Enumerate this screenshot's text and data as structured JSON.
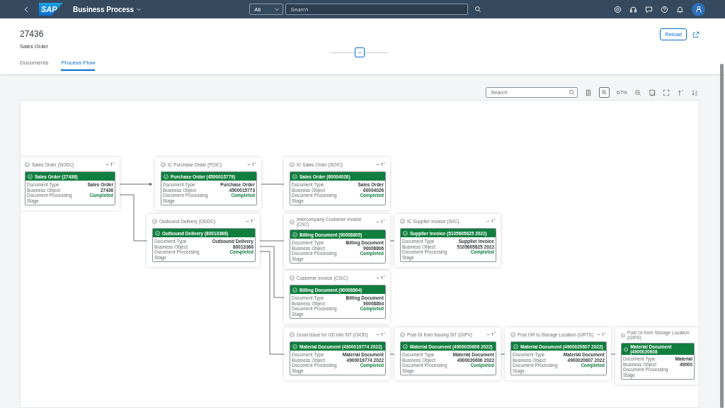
{
  "shell": {
    "logo": "SAP",
    "title": "Business Process",
    "scope": "All",
    "search_placeholder": "Search"
  },
  "object": {
    "title": "27436",
    "subtitle": "Sales Order",
    "reload": "Reload"
  },
  "tabs": [
    {
      "label": "Documents",
      "selected": false
    },
    {
      "label": "Process Flow",
      "selected": true
    }
  ],
  "toolbar": {
    "search_placeholder": "Search",
    "zoom": "67%"
  },
  "lanes": [
    {
      "title": "Sales Order (SOSC)",
      "color": "#107e3e",
      "header": "Sales Order (27436)",
      "rows": [
        {
          "label": "Document Type",
          "value": "Sales Order",
          "kind": "text"
        },
        {
          "label": "Business Object",
          "value": "27436",
          "kind": "text"
        },
        {
          "label": "Document Processing Stage",
          "value": "Completed",
          "kind": "status"
        }
      ]
    },
    {
      "title": "IC Purchase Order (POIC)",
      "color": "#107e3e",
      "header": "Purchase Order (4500015779)",
      "rows": [
        {
          "label": "Document Type",
          "value": "Purchase Order",
          "kind": "text"
        },
        {
          "label": "Business Object",
          "value": "4500015773",
          "kind": "text"
        },
        {
          "label": "Document Processing Stage",
          "value": "Completed",
          "kind": "status"
        }
      ]
    },
    {
      "title": "Outbound Delivery (ODDC)",
      "color": "#107e3e",
      "header": "Outbound Delivery (80013366)",
      "rows": [
        {
          "label": "Document Type",
          "value": "Outbound Delivery",
          "kind": "text"
        },
        {
          "label": "Business Object",
          "value": "80013366",
          "kind": "text"
        },
        {
          "label": "Document Processing Stage",
          "value": "Completed",
          "kind": "status"
        }
      ]
    },
    {
      "title": "IC Sales Order (SOIC)",
      "color": "#107e3e",
      "header": "Sales Order (60004026)",
      "rows": [
        {
          "label": "Document Type",
          "value": "Sales Order",
          "kind": "text"
        },
        {
          "label": "Business Object",
          "value": "60004026",
          "kind": "text"
        },
        {
          "label": "Document Processing Stage",
          "value": "Completed",
          "kind": "status"
        }
      ]
    },
    {
      "title": "Intercompany Customer Invoice (CIIC)",
      "color": "#107e3e",
      "header": "Billing Document (90008805)",
      "rows": [
        {
          "label": "Document Type",
          "value": "Billing Document",
          "kind": "text"
        },
        {
          "label": "Business Object",
          "value": "90008806",
          "kind": "text"
        },
        {
          "label": "Document Processing Stage",
          "value": "Completed",
          "kind": "status"
        }
      ]
    },
    {
      "title": "IC Supplier Invoice (SIIC)",
      "color": "#107e3e",
      "header": "Supplier Invoice (5105605625 2022)",
      "rows": [
        {
          "label": "Document Type",
          "value": "Supplier Invoice",
          "kind": "text"
        },
        {
          "label": "Business Object",
          "value": "5105605625 2022",
          "kind": "text"
        },
        {
          "label": "Document Processing Stage",
          "value": "Completed",
          "kind": "status"
        }
      ]
    },
    {
      "title": "Customer Invoice (CISC)",
      "color": "#107e3e",
      "header": "Billing Document (90008804)",
      "rows": [
        {
          "label": "Document Type",
          "value": "Billing Document",
          "kind": "text"
        },
        {
          "label": "Business Object",
          "value": "90008804",
          "kind": "text"
        },
        {
          "label": "Document Processing Stage",
          "value": "Completed",
          "kind": "status"
        }
      ]
    },
    {
      "title": "Good Issue for OD into SiT (GIOD)",
      "color": "#107e3e",
      "header": "Material Document (4900019774 2022)",
      "rows": [
        {
          "label": "Document Type",
          "value": "Material Document",
          "kind": "text"
        },
        {
          "label": "Business Object",
          "value": "4900019774 2022",
          "kind": "text"
        },
        {
          "label": "Document Processing Stage",
          "value": "Completed",
          "kind": "status"
        }
      ]
    },
    {
      "title": "Post GI from Issuing SiT (GIPV)",
      "color": "#107e3e",
      "header": "Material Document (4900020606 2022)",
      "rows": [
        {
          "label": "Document Type",
          "value": "Material Document",
          "kind": "text"
        },
        {
          "label": "Business Object",
          "value": "4900020606 2022",
          "kind": "text"
        },
        {
          "label": "Document Processing Stage",
          "value": "Completed",
          "kind": "status"
        }
      ]
    },
    {
      "title": "Post GR to Storage Location (GRTS)",
      "color": "#107e3e",
      "header": "Material Document (4900020607 2022)",
      "rows": [
        {
          "label": "Document Type",
          "value": "Material Document",
          "kind": "text"
        },
        {
          "label": "Business Object",
          "value": "4900020607 2022",
          "kind": "text"
        },
        {
          "label": "Document Processing Stage",
          "value": "Completed",
          "kind": "status"
        }
      ]
    },
    {
      "title": "Post GI from Storage Location (GIFS)",
      "color": "#107e3e",
      "header": "Material Document (4900020608",
      "rows": [
        {
          "label": "Document Type",
          "value": "Material",
          "kind": "text"
        },
        {
          "label": "Business Object",
          "value": "49000",
          "kind": "text"
        },
        {
          "label": "Document Processing Stage"
        }
      ]
    }
  ]
}
